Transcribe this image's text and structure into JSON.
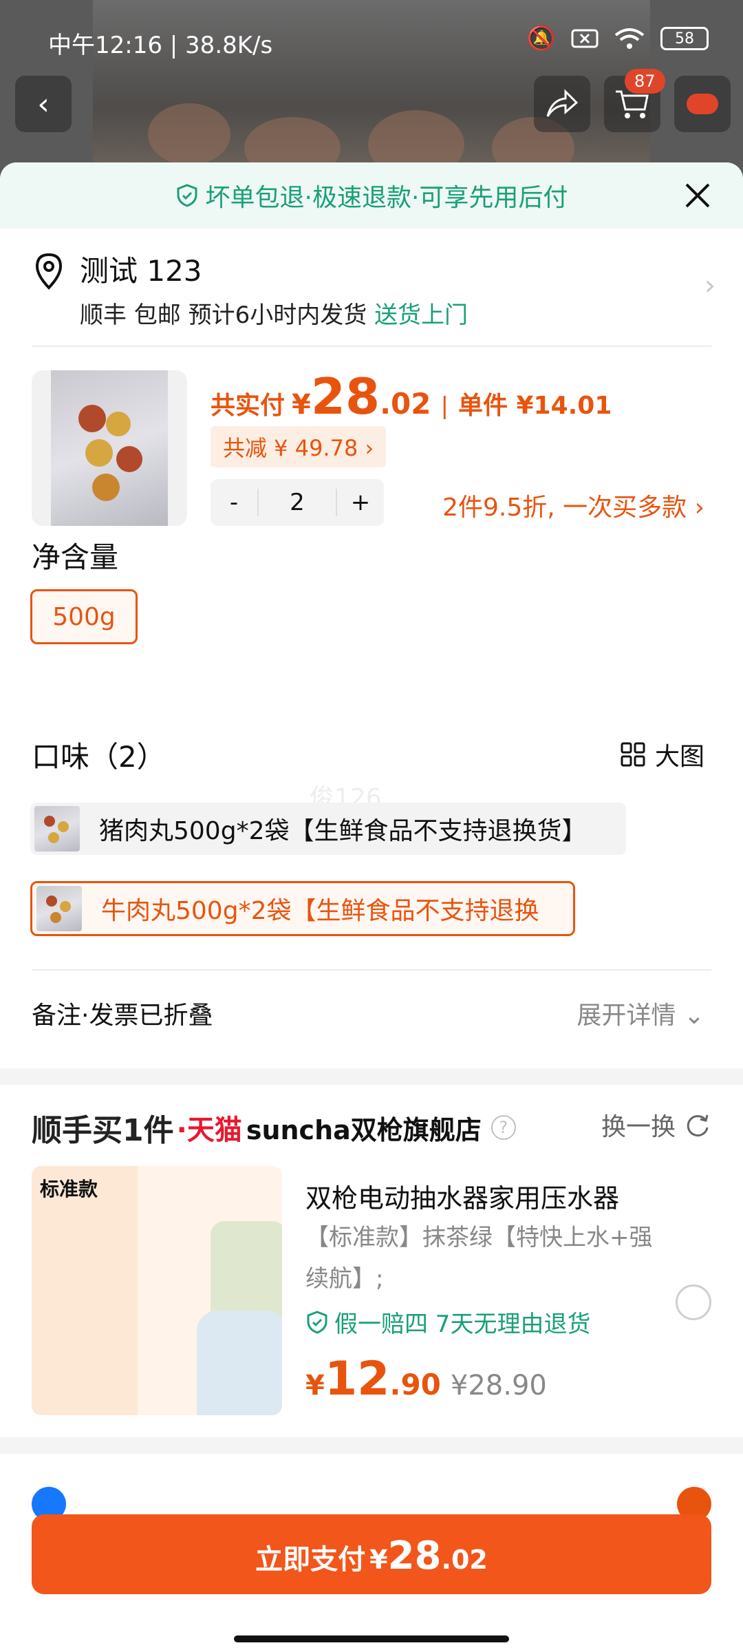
{
  "status_bar": {
    "time_text": "中午12:16 | 38.8K/s",
    "battery": "58"
  },
  "top_actions": {
    "cart_badge": "87"
  },
  "sheet": {
    "guarantee_text": "坏单包退·极速退款·可享先用后付",
    "address": {
      "name": "测试 123",
      "shipping_prefix": "顺丰 包邮 预计6小时内发货",
      "shipping_highlight": "送货上门"
    },
    "product": {
      "total_label": "共实付",
      "currency": "¥",
      "price_int": "28",
      "price_dec": ".02",
      "unit_label": "单件 ¥14.01",
      "saving_label": "共减 ¥ 49.78 ›",
      "quantity": "2",
      "minus": "-",
      "plus": "+",
      "promo": "2件9.5折, 一次买多款  ›"
    },
    "net_weight": {
      "title": "净含量",
      "options": [
        "500g"
      ]
    },
    "flavor": {
      "title": "口味（2）",
      "big_view": "大图",
      "options": [
        {
          "label": "猪肉丸500g*2袋【生鲜食品不支持退换货】",
          "selected": false
        },
        {
          "label": "牛肉丸500g*2袋【生鲜食品不支持退换",
          "selected": true
        }
      ]
    },
    "notes": {
      "label": "备注·发票已折叠",
      "expand": "展开详情"
    },
    "upsell": {
      "brand": "顺手买1件",
      "tmall": "·天猫",
      "store": "suncha双枪旗舰店",
      "swap": "换一换",
      "image_title": "标准款",
      "title": "双枪电动抽水器家用压水器",
      "spec": "【标准款】抹茶绿【特快上水+强续航】;",
      "guarantee": "假一赔四  7天无理由退货",
      "currency": "¥",
      "price_int": "12",
      "price_dec": ".90",
      "orig_price": "¥28.90"
    },
    "pay_button": {
      "label": "立即支付",
      "currency": "¥",
      "price_int": "28",
      "price_dec": ".02"
    }
  },
  "colors": {
    "accent": "#f2561b",
    "green": "#1a9f78",
    "tmall_red": "#e8182f"
  }
}
